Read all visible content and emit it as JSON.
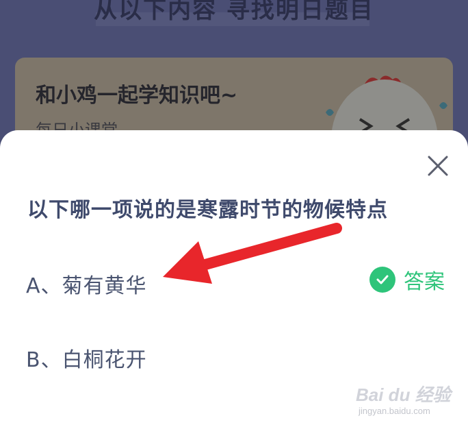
{
  "background": {
    "top_title": "从以下内容 寻找明日题目",
    "card_title": "和小鸡一起学知识吧~",
    "card_subtitle": "每日小课堂"
  },
  "quiz": {
    "question": "以下哪一项说的是寒露时节的物候特点",
    "options": [
      {
        "label": "A、菊有黄华",
        "is_answer": true
      },
      {
        "label": "B、白桐花开",
        "is_answer": false
      }
    ],
    "answer_label": "答案"
  },
  "watermark": {
    "brand": "Bai du 经验",
    "url": "jingyan.baidu.com"
  },
  "colors": {
    "accent_green": "#2ec47a",
    "question_text": "#3f4a6c",
    "arrow_red": "#e8262b"
  },
  "icons": {
    "close": "close-icon",
    "check": "check-circle-icon",
    "arrow": "red-arrow-annotation"
  }
}
